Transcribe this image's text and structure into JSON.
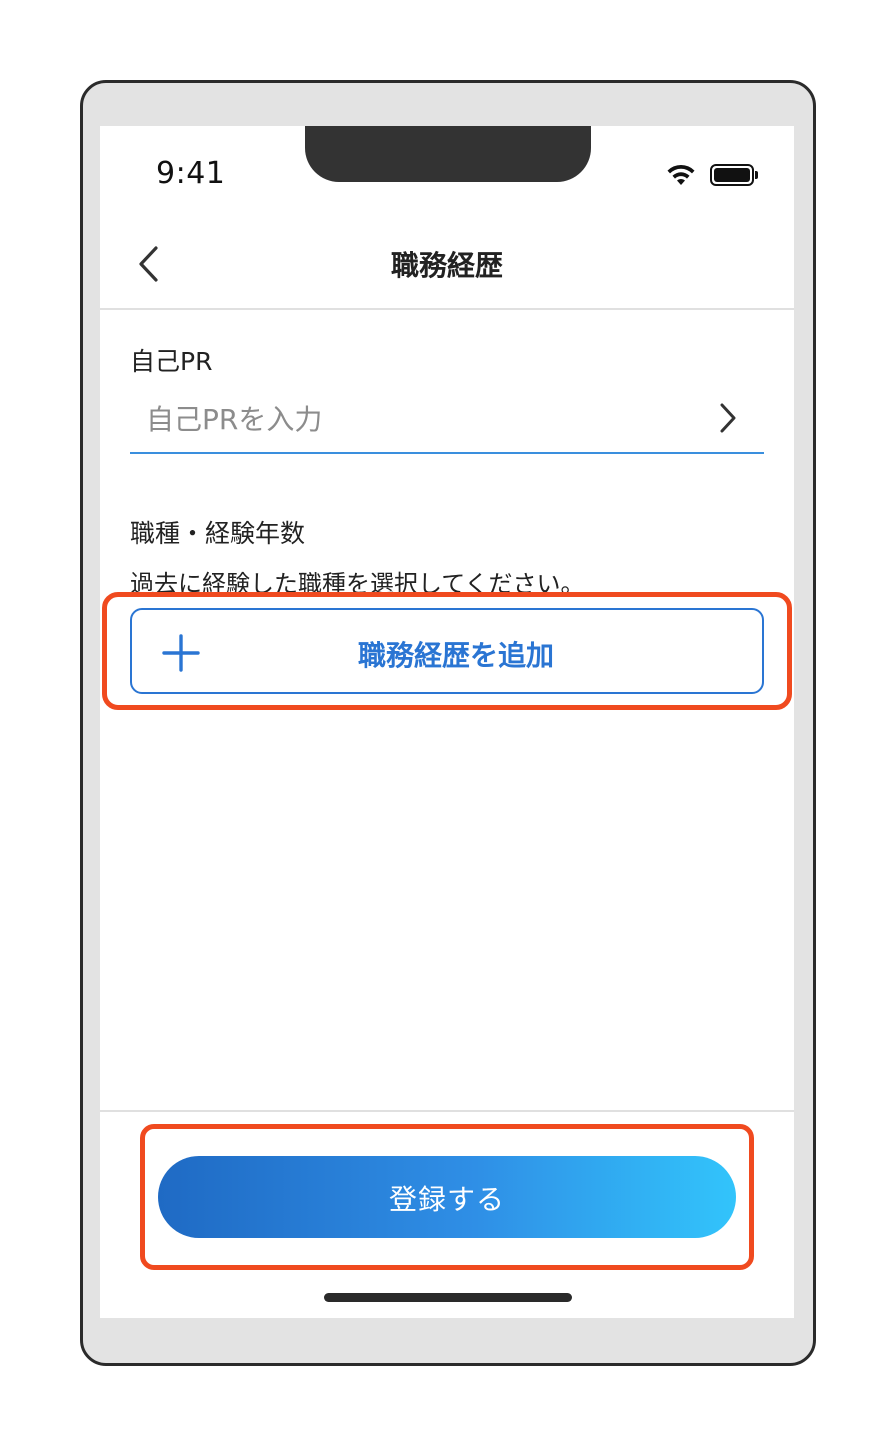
{
  "status_bar": {
    "time": "9:41",
    "icons": [
      "wifi-icon",
      "battery-icon"
    ]
  },
  "navbar": {
    "title": "職務経歴",
    "back_icon": "chevron-left-icon"
  },
  "self_pr": {
    "label": "自己PR",
    "placeholder": "自己PRを入力",
    "value": "",
    "accessory_icon": "chevron-right-icon"
  },
  "job_experience": {
    "title": "職種・経験年数",
    "description": "過去に経験した職種を選択してください。",
    "add_button_label": "職務経歴を追加",
    "add_icon": "plus-icon"
  },
  "footer": {
    "submit_label": "登録する"
  },
  "colors": {
    "accent": "#2a75d3",
    "highlight": "#f04a1f",
    "gradient_start": "#1f6ac4",
    "gradient_end": "#32c4fb",
    "input_underline": "#3a8fde"
  }
}
